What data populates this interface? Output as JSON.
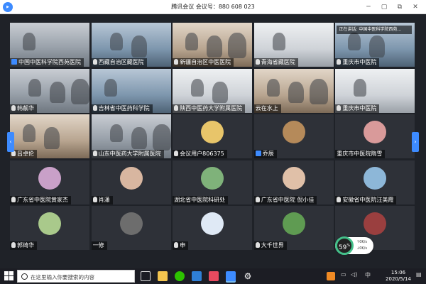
{
  "window": {
    "title": "腾讯会议 会议号：880 608 023",
    "logo_icon": "tencent-meeting-logo",
    "controls": [
      "minimize-icon",
      "maximize-icon",
      "restore-icon",
      "close-icon"
    ]
  },
  "meeting": {
    "speaking_banner": "正在讲话: 中国中医科学院西苑...",
    "participants": [
      {
        "name": "中国中医科学院西苑医院",
        "style": "video",
        "marker": "person"
      },
      {
        "name": "西藏自治区藏医院",
        "style": "video blue",
        "marker": "mic"
      },
      {
        "name": "新疆自治区中医医院",
        "style": "video warm",
        "marker": "mic"
      },
      {
        "name": "青海省藏医院",
        "style": "video white",
        "marker": "mic"
      },
      {
        "name": "重庆市中医院",
        "style": "video blue",
        "marker": "mic"
      },
      {
        "name": "韩靓华",
        "style": "video",
        "marker": "mic"
      },
      {
        "name": "吉林省中医药科学院",
        "style": "video blue",
        "marker": "mic"
      },
      {
        "name": "陕西中医药大学附属医院",
        "style": "video white",
        "marker": "mic"
      },
      {
        "name": "云在水上",
        "style": "video warm",
        "marker": "none"
      },
      {
        "name": "重庆市中医院",
        "style": "video white",
        "marker": "mic"
      },
      {
        "name": "吕卓伦",
        "style": "video warm",
        "marker": "mic"
      },
      {
        "name": "山东中医药大学附属医院",
        "style": "video",
        "marker": "mic"
      },
      {
        "name": "会议用户806375",
        "style": "avatar",
        "marker": "mic",
        "avatar_color": "#e8c56a"
      },
      {
        "name": "乔辰",
        "style": "avatar",
        "marker": "person",
        "avatar_color": "#b58a5a"
      },
      {
        "name": "重庆市中医院隋雪",
        "style": "avatar",
        "marker": "none",
        "avatar_color": "#d99a9a"
      },
      {
        "name": "广东省中医院黄家杰",
        "style": "avatar",
        "marker": "mic",
        "avatar_color": "#c9a0c8"
      },
      {
        "name": "肖潇",
        "style": "avatar",
        "marker": "mic",
        "avatar_color": "#d8b6a0"
      },
      {
        "name": "湖北省中医院科研处",
        "style": "avatar",
        "marker": "none",
        "avatar_color": "#7fb27a"
      },
      {
        "name": "广东省中医院 倪小佳",
        "style": "avatar",
        "marker": "mic",
        "avatar_color": "#e0c0a8"
      },
      {
        "name": "安徽省中医院汪美霞",
        "style": "avatar",
        "marker": "mic",
        "avatar_color": "#8db7d8"
      },
      {
        "name": "郭绮华",
        "style": "avatar",
        "marker": "mic",
        "avatar_color": "#a9c98b"
      },
      {
        "name": "一修",
        "style": "avatar",
        "marker": "none",
        "avatar_color": "#6d6d6d"
      },
      {
        "name": "申",
        "style": "avatar",
        "marker": "mic",
        "avatar_color": "#dfe9f5"
      },
      {
        "name": "大千世界",
        "style": "avatar",
        "marker": "mic",
        "avatar_color": "#5f9b52"
      },
      {
        "name": "",
        "style": "avatar",
        "marker": "none",
        "avatar_color": "#9a3f3f"
      }
    ]
  },
  "network": {
    "score": "59",
    "unit": "%",
    "upload": "0K/s",
    "download": "0K/s"
  },
  "taskbar": {
    "search_placeholder": "在这里输入你要搜索的内容",
    "time": "15:06",
    "date": "2020/5/14",
    "ime": "中",
    "icons": [
      "cortana-icon",
      "task-view-icon",
      "file-explorer-icon",
      "wechat-icon",
      "edge-icon",
      "photos-icon",
      "tencent-meeting-icon",
      "settings-icon"
    ],
    "tray_icons": [
      "sogou-ime-icon",
      "network-icon",
      "volume-icon",
      "notification-icon"
    ]
  },
  "colors": {
    "accent": "#3d8bff",
    "network_ok": "#44c08a"
  }
}
